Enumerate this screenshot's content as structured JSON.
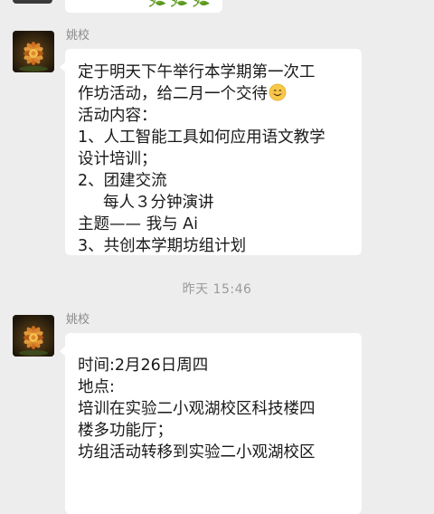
{
  "top_message": {
    "emoji": "🌿🌿🌿"
  },
  "messages": [
    {
      "sender": "姚校",
      "lines": [
        "定于明天下午举行本学期第一次工",
        "作坊活动，给二月一个交待",
        "活动内容：",
        "1、人工智能工具如何应用语文教学",
        "设计培训；",
        "2、团建交流",
        "每人３分钟演讲",
        "主题—— 我与 Ai",
        "3、共创本学期坊组计划"
      ]
    },
    {
      "sender": "姚校",
      "lines": [
        "时间:2月26日周四",
        "地点:",
        "培训在实验二小观湖校区科技楼四",
        "楼多功能厅；",
        "坊组活动转移到实验二小观湖校区"
      ]
    }
  ],
  "time_divider": "昨天 15:46",
  "colors": {
    "background": "#ededed",
    "bubble": "#ffffff",
    "sender": "#8a8a8a",
    "time": "#9b9b9b",
    "text": "#191919"
  },
  "icons": {
    "avatar": "lotus-flower-avatar-icon",
    "emoji": "smiling-face-emoji-icon"
  }
}
